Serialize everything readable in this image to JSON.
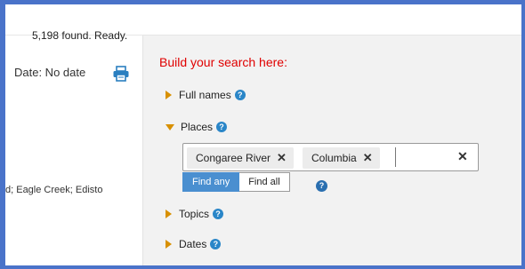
{
  "status": {
    "text": "5,198 found. Ready."
  },
  "left": {
    "date_text": "Date: No date",
    "print_icon": "printer-icon",
    "places_fragment": "d; Eagle Creek; Edisto"
  },
  "builder": {
    "title": "Build your search here:",
    "sections": {
      "full_names": "Full names",
      "places": "Places",
      "topics": "Topics",
      "dates": "Dates"
    },
    "help_glyph": "?",
    "places_tags": [
      "Congaree River",
      "Columbia"
    ],
    "tag_remove_glyph": "✕",
    "clear_glyph": "✕",
    "match_mode": {
      "any_label": "Find any",
      "all_label": "Find all",
      "selected": "any"
    }
  },
  "colors": {
    "accent_border": "#4a73c9",
    "title_red": "#e00000",
    "triangle": "#d89000",
    "active_toggle": "#4a8fd0",
    "help_blue": "#2a86c8"
  }
}
